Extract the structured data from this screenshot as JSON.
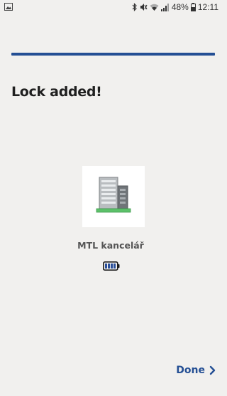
{
  "status_bar": {
    "battery_percent": "48%",
    "time": "12:11",
    "icons": [
      "image-icon",
      "bluetooth-icon",
      "mute-icon",
      "wifi-icon",
      "signal-icon",
      "battery-icon"
    ]
  },
  "onboarding": {
    "progress_fraction": 1.0,
    "title": "Lock added!"
  },
  "lock": {
    "name": "MTL kancelář",
    "icon": "building-icon",
    "battery_level": "full",
    "battery_icon": "battery-full-icon"
  },
  "footer": {
    "done_label": "Done",
    "done_icon": "chevron-right-icon"
  },
  "colors": {
    "accent": "#244f94",
    "background": "#f1f0ee",
    "card": "#ffffff",
    "green_base": "#5cc16a"
  }
}
